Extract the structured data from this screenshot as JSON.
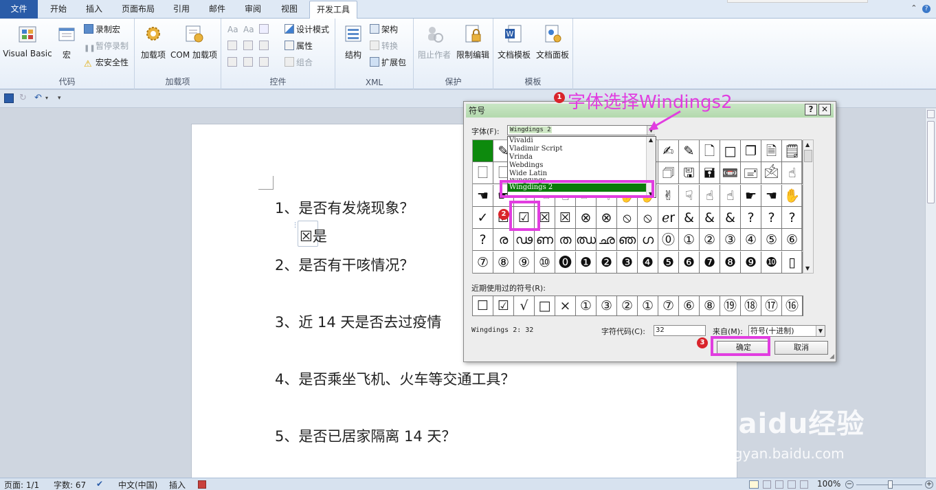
{
  "tabs": [
    "文件",
    "开始",
    "插入",
    "页面布局",
    "引用",
    "邮件",
    "审阅",
    "视图",
    "开发工具"
  ],
  "ribbon": {
    "code": {
      "label": "代码",
      "visual_basic": "Visual Basic",
      "macro": "宏",
      "record_macro": "录制宏",
      "pause_record": "暂停录制",
      "macro_security": "宏安全性"
    },
    "addins": {
      "label": "加载项",
      "addins": "加载项",
      "com_addins": "COM 加载项"
    },
    "controls": {
      "label": "控件",
      "aa1": "Aa",
      "aa2": "Aa",
      "design_mode": "设计模式",
      "properties": "属性",
      "group": "组合"
    },
    "xml": {
      "label": "XML",
      "structure": "结构",
      "schema": "架构",
      "transform": "转换",
      "expansion": "扩展包"
    },
    "protect": {
      "label": "保护",
      "block_authors": "阻止作者",
      "restrict_editing": "限制编辑"
    },
    "templates": {
      "label": "模板",
      "doc_template": "文档模板",
      "doc_panel": "文档面板"
    }
  },
  "document": {
    "q1": "1、是否有发烧现象？",
    "a1": "☒是",
    "q2": "2、是否有干咳情况？",
    "q3": "3、近 14 天是否去过疫情",
    "q4": "4、是否乘坐飞机、火车等交通工具？",
    "q5": "5、是否已居家隔离 14 天？"
  },
  "dialog": {
    "title": "符号",
    "help": "?",
    "close": "✕",
    "font_label": "字体(F):",
    "font_value": "Wingdings 2",
    "font_list": [
      "Vivaldi",
      "Vladimir Script",
      "Vrinda",
      "Webdings",
      "Wide Latin",
      "Wingdings",
      "Wingdings 2"
    ],
    "grid_rows": [
      [
        "",
        "✎",
        "✂",
        "✄",
        "✁",
        "✆",
        "✉",
        "☏",
        "✌",
        "✍",
        "✎",
        "🗋",
        "□",
        "❐",
        "🗎",
        "🗒",
        "❏",
        "🗋"
      ],
      [
        "🗌",
        "🗌",
        "🖶",
        "🗍",
        "🗊",
        "🖂",
        "🖃",
        "🖄",
        "🖅",
        "🗇",
        "🖫",
        "🖬",
        "📼",
        "🖃",
        "🖄",
        "☝",
        "☜",
        "☞"
      ],
      [
        "☚",
        "☛",
        "☟",
        "☜",
        "☝",
        "☞",
        "☟",
        "✋",
        "✋",
        "✌",
        "☟",
        "☝",
        "☝",
        "☛",
        "☚",
        "✋",
        "✋",
        "✕"
      ],
      [
        "✓",
        "☑",
        "☑",
        "☒",
        "☒",
        "⊗",
        "⊗",
        "⦸",
        "⦸",
        "ℯr",
        "&",
        "&",
        "&",
        "?",
        "?",
        "?"
      ],
      [
        "?",
        "ര",
        "ഢ",
        "ണ",
        "ത",
        "ഝ",
        "ഛ",
        "ഞ",
        "ഗ",
        "⓪",
        "①",
        "②",
        "③",
        "④",
        "⑤",
        "⑥"
      ],
      [
        "⑦",
        "⑧",
        "⑨",
        "⑩",
        "⓿",
        "❶",
        "❷",
        "❸",
        "❹",
        "❺",
        "❻",
        "❼",
        "❽",
        "❾",
        "❿",
        "▯"
      ]
    ],
    "recent_label": "近期使用过的符号(R):",
    "recent": [
      "☐",
      "☑",
      "√",
      "□",
      "×",
      "①",
      "③",
      "②",
      "①",
      "⑦",
      "⑥",
      "⑧",
      "⑲",
      "⑱",
      "⑰",
      "⑯"
    ],
    "font_code_text": "Wingdings 2: 32",
    "code_label": "字符代码(C):",
    "code_value": "32",
    "from_label": "来自(M):",
    "from_value": "符号(十进制)",
    "ok": "确定",
    "cancel": "取消"
  },
  "annotations": {
    "step1_badge": "1",
    "step1_text": "字体选择Windings2",
    "step2_badge": "2",
    "step3_badge": "3",
    "highlight_color": "#e13de0"
  },
  "status": {
    "page": "页面: 1/1",
    "words": "字数: 67",
    "language": "中文(中国)",
    "insert": "插入",
    "zoom": "100%"
  },
  "watermark": {
    "logo": "Baidu经验",
    "url": "jingyan.baidu.com"
  }
}
